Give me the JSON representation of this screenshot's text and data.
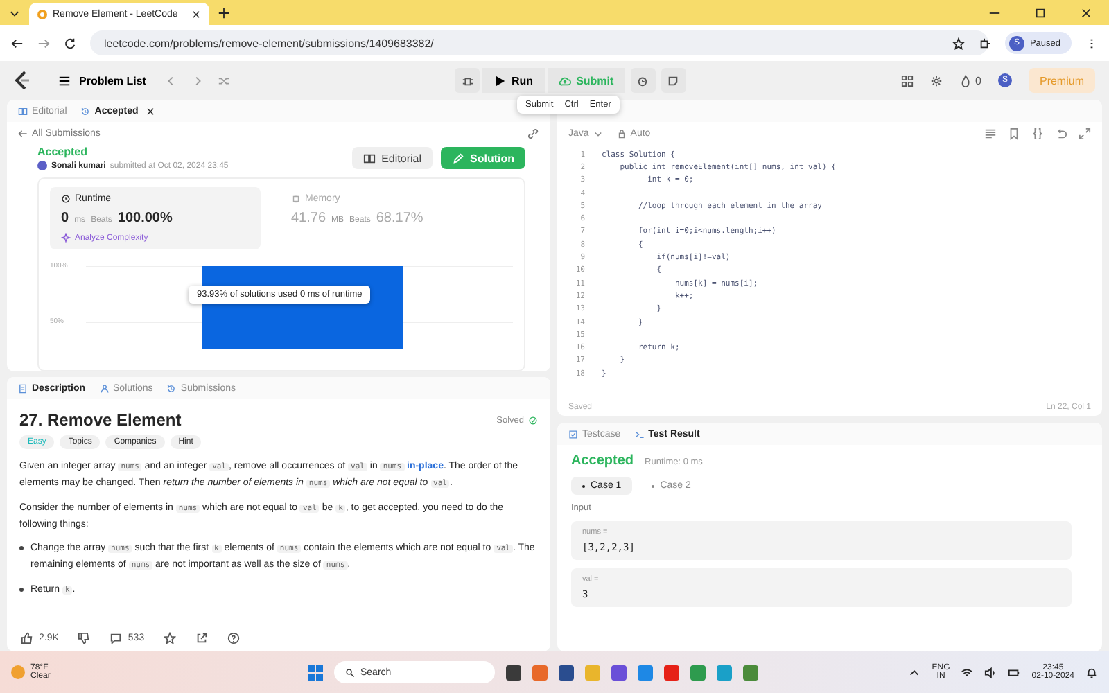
{
  "browser": {
    "tab_title": "Remove Element - LeetCode",
    "url": "leetcode.com/problems/remove-element/submissions/1409683382/",
    "profile_status": "Paused",
    "profile_initial": "S"
  },
  "navbar": {
    "problem_list": "Problem List",
    "run": "Run",
    "submit": "Submit",
    "streak": "0",
    "avatar_initial": "S",
    "premium": "Premium"
  },
  "shortcut_tooltip": [
    "Submit",
    "Ctrl",
    "Enter"
  ],
  "left_top_tabs": [
    {
      "label": "Editorial",
      "selected": false,
      "closable": false
    },
    {
      "label": "Accepted",
      "selected": true,
      "closable": true
    }
  ],
  "submission": {
    "back": "All Submissions",
    "status": "Accepted",
    "user": "Sonali kumari",
    "submitted": "submitted at Oct 02, 2024 23:45",
    "editorial_button": "Editorial",
    "solution_button": "Solution",
    "runtime": {
      "label": "Runtime",
      "value": "0",
      "unit": "ms",
      "beats": "Beats",
      "percent": "100.00%",
      "analyze": "Analyze Complexity"
    },
    "memory": {
      "label": "Memory",
      "value": "41.76",
      "unit": "MB",
      "beats": "Beats",
      "percent": "68.17%"
    },
    "distribution": {
      "gridlines": [
        "100%",
        "50%"
      ],
      "tooltip": "93.93% of solutions used 0 ms of runtime"
    }
  },
  "editor": {
    "language": "Java",
    "mode": "Auto",
    "lines": [
      {
        "number": "1",
        "code": "class Solution {"
      },
      {
        "number": "2",
        "code": "    public int removeElement(int[] nums, int val) {"
      },
      {
        "number": "3",
        "code": "          int k = 0;"
      },
      {
        "number": "4"
      },
      {
        "number": "5",
        "code": "        //loop through each element in the array"
      },
      {
        "number": "6"
      },
      {
        "number": "7",
        "code": "        for(int i=0;i<nums.length;i++)"
      },
      {
        "number": "8",
        "code": "        {"
      },
      {
        "number": "9",
        "code": "            if(nums[i]!=val)"
      },
      {
        "number": "10",
        "code": "            {"
      },
      {
        "number": "11",
        "code": "                nums[k] = nums[i];"
      },
      {
        "number": "12",
        "code": "                k++;"
      },
      {
        "number": "13",
        "code": "            }"
      },
      {
        "number": "14",
        "code": "        }"
      },
      {
        "number": "15"
      },
      {
        "number": "16",
        "code": "        return k;"
      },
      {
        "number": "17",
        "code": "    }"
      },
      {
        "number": "18",
        "code": "}"
      }
    ],
    "saved": "Saved",
    "cursor": "Ln 22, Col 1"
  },
  "description_tabs": [
    {
      "label": "Description",
      "selected": true
    },
    {
      "label": "Solutions",
      "selected": false
    },
    {
      "label": "Submissions",
      "selected": false
    }
  ],
  "problem": {
    "title": "27. Remove Element",
    "solved": "Solved",
    "difficulty": "Easy",
    "tags": [
      "Topics",
      "Companies",
      "Hint"
    ],
    "paragraphs": [
      [
        {
          "kind": "text",
          "text": "Given an integer array "
        },
        {
          "kind": "code",
          "text": "nums"
        },
        {
          "kind": "text",
          "text": " and an integer "
        },
        {
          "kind": "code",
          "text": "val"
        },
        {
          "kind": "text",
          "text": ", remove all occurrences of "
        },
        {
          "kind": "code",
          "text": "val"
        },
        {
          "kind": "text",
          "text": " in "
        },
        {
          "kind": "code",
          "text": "nums"
        },
        {
          "kind": "link",
          "text": " in-place"
        },
        {
          "kind": "text",
          "text": ". The order of the elements may be changed. Then "
        },
        {
          "kind": "italic",
          "text": "return the number of elements in "
        },
        {
          "kind": "code",
          "text": "nums"
        },
        {
          "kind": "italic",
          "text": " which are not equal to "
        },
        {
          "kind": "code",
          "text": "val"
        },
        {
          "kind": "text",
          "text": "."
        }
      ],
      [
        {
          "kind": "text",
          "text": "Consider the number of elements in "
        },
        {
          "kind": "code",
          "text": "nums"
        },
        {
          "kind": "text",
          "text": " which are not equal to "
        },
        {
          "kind": "code",
          "text": "val"
        },
        {
          "kind": "text",
          "text": " be "
        },
        {
          "kind": "code",
          "text": "k"
        },
        {
          "kind": "text",
          "text": ", to get accepted, you need to do the following things:"
        }
      ]
    ],
    "bullets": [
      [
        {
          "kind": "text",
          "text": "Change the array "
        },
        {
          "kind": "code",
          "text": "nums"
        },
        {
          "kind": "text",
          "text": " such that the first "
        },
        {
          "kind": "code",
          "text": "k"
        },
        {
          "kind": "text",
          "text": " elements of "
        },
        {
          "kind": "code",
          "text": "nums"
        },
        {
          "kind": "text",
          "text": " contain the elements which are not equal to "
        },
        {
          "kind": "code",
          "text": "val"
        },
        {
          "kind": "text",
          "text": ". The remaining elements of "
        },
        {
          "kind": "code",
          "text": "nums"
        },
        {
          "kind": "text",
          "text": " are not important as well as the size of "
        },
        {
          "kind": "code",
          "text": "nums"
        },
        {
          "kind": "text",
          "text": "."
        }
      ],
      [
        {
          "kind": "text",
          "text": "Return "
        },
        {
          "kind": "code",
          "text": "k"
        },
        {
          "kind": "text",
          "text": "."
        }
      ]
    ],
    "likes": "2.9K",
    "comments": "533"
  },
  "console_tabs": [
    {
      "label": "Testcase",
      "selected": false
    },
    {
      "label": "Test Result",
      "selected": true
    }
  ],
  "result": {
    "status": "Accepted",
    "runtime": "Runtime: 0 ms",
    "cases": [
      {
        "label": "Case 1",
        "selected": true
      },
      {
        "label": "Case 2",
        "selected": false
      }
    ],
    "input_label": "Input",
    "inputs": [
      {
        "name": "nums =",
        "value": "[3,2,2,3]"
      },
      {
        "name": "val =",
        "value": "3"
      }
    ]
  },
  "taskbar": {
    "temperature": "78°F",
    "weather": "Clear",
    "search": "Search",
    "language": "ENG",
    "region": "IN",
    "time": "23:45",
    "date": "02-10-2024"
  }
}
